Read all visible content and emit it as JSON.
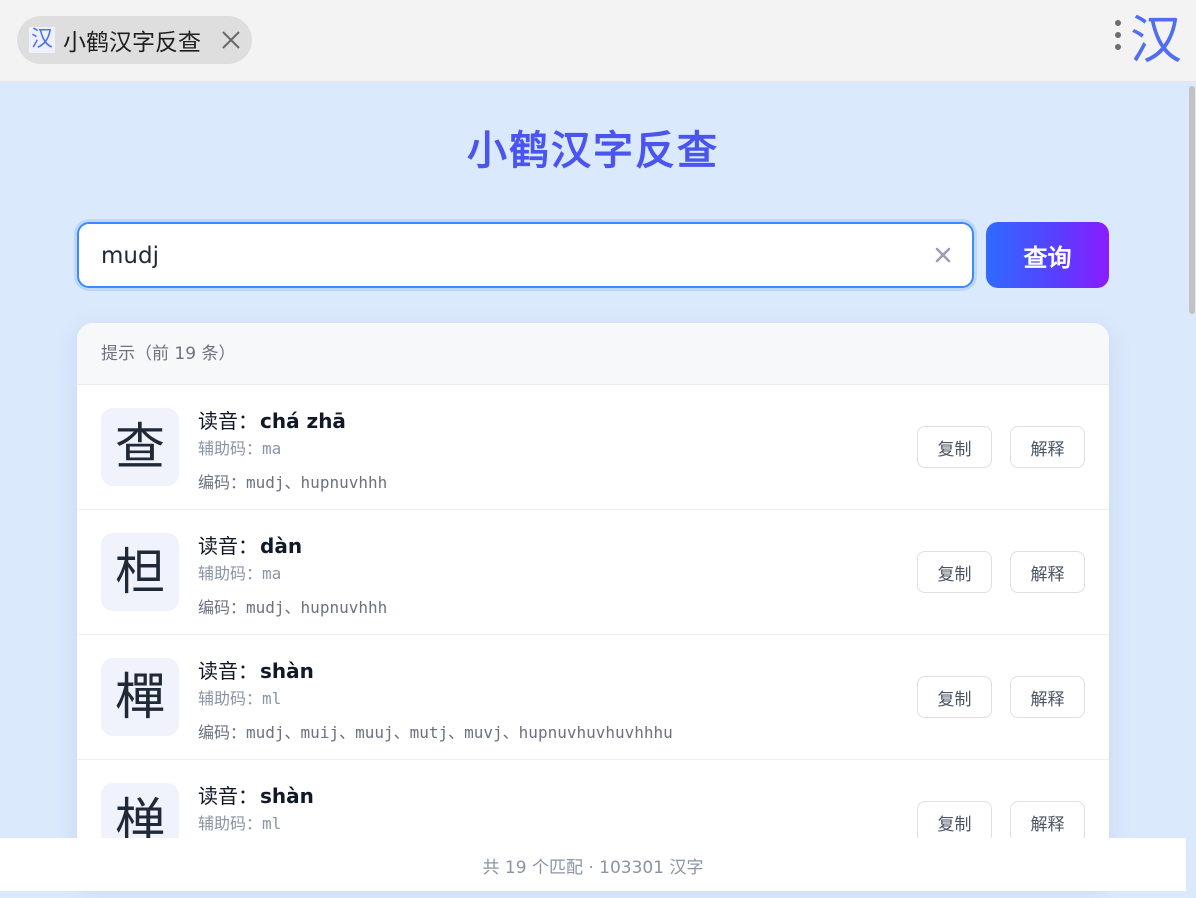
{
  "browser_tab": {
    "icon_glyph": "汉",
    "title": "小鹤汉字反查",
    "close_icon": "close-icon"
  },
  "corner_logo": "汉",
  "app": {
    "title": "小鹤汉字反查"
  },
  "search": {
    "value": "mudj",
    "query_label": "查询"
  },
  "results": {
    "header": "提示（前 19 条）",
    "items": [
      {
        "char": "查",
        "reading_label": "读音：",
        "pinyin": "chá zhā",
        "aux_label": "辅助码：",
        "aux": "ma",
        "codes_label": "编码：",
        "codes": "mudj、hupnuvhhh",
        "copy_label": "复制",
        "explain_label": "解释"
      },
      {
        "char": "柦",
        "reading_label": "读音：",
        "pinyin": "dàn",
        "aux_label": "辅助码：",
        "aux": "ma",
        "codes_label": "编码：",
        "codes": "mudj、hupnuvhhh",
        "copy_label": "复制",
        "explain_label": "解释"
      },
      {
        "char": "樿",
        "reading_label": "读音：",
        "pinyin": "shàn",
        "aux_label": "辅助码：",
        "aux": "ml",
        "codes_label": "编码：",
        "codes": "mudj、muij、muuj、mutj、muvj、hupnuvhuvhuvhhhu",
        "copy_label": "复制",
        "explain_label": "解释"
      },
      {
        "char": "椫",
        "reading_label": "读音：",
        "pinyin": "shàn",
        "aux_label": "辅助码：",
        "aux": "ml",
        "codes_label": "编码：",
        "codes": "",
        "copy_label": "复制",
        "explain_label": "解释"
      }
    ]
  },
  "footer": {
    "text": "共 19 个匹配 · 103301 汉字"
  },
  "colors": {
    "accent": "#4a55f0",
    "background": "#dbe9fd",
    "button_gradient_start": "#2f6bff",
    "button_gradient_end": "#8b1cff"
  }
}
